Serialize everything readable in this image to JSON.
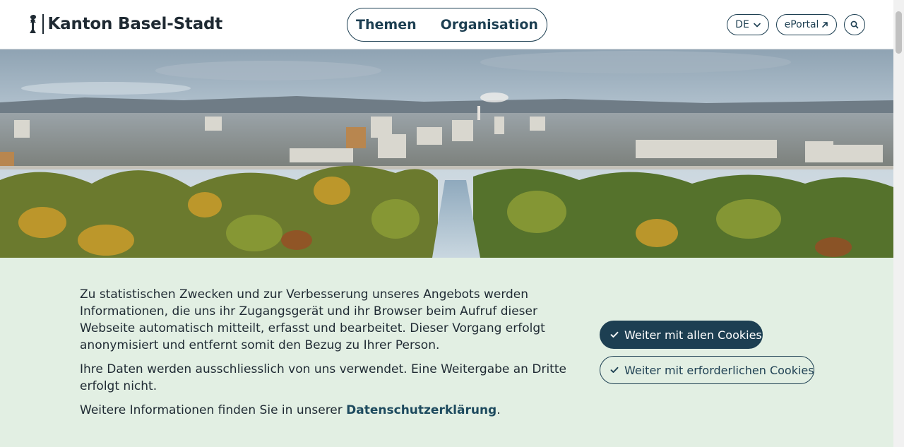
{
  "header": {
    "site_title": "Kanton Basel-Stadt",
    "nav": [
      {
        "label": "Themen"
      },
      {
        "label": "Organisation"
      }
    ],
    "language": "DE",
    "eportal_label": "ePortal",
    "icons": {
      "logo": "baselstab-icon",
      "language_dropdown": "chevron-down-icon",
      "eportal_external": "arrow-up-right-icon",
      "search": "search-icon"
    }
  },
  "hero": {
    "image_description": "aerial-city-panorama"
  },
  "cookie_banner": {
    "paragraph_1": "Zu statistischen Zwecken und zur Verbesserung unseres Angebots werden Informationen, die uns ihr Zugangsgerät und ihr Browser beim Aufruf dieser Webseite automatisch mitteilt, erfasst und bearbeitet. Dieser Vorgang erfolgt anonymisiert und entfernt somit den Bezug zu Ihrer Person.",
    "paragraph_2": "Ihre Daten werden ausschliesslich von uns verwendet. Eine Weitergabe an Dritte erfolgt nicht.",
    "paragraph_3_prefix": "Weitere Informationen finden Sie in unserer ",
    "privacy_link": "Datenschutzerklärung",
    "paragraph_3_suffix": ".",
    "accept_all_label": "Weiter mit allen Cookies",
    "accept_required_label": "Weiter mit erforderlichen Cookies",
    "button_icon": "check-icon"
  },
  "colors": {
    "brand_dark": "#1d3f52",
    "banner_bg": "#e2efe3",
    "text": "#1f2a33"
  }
}
